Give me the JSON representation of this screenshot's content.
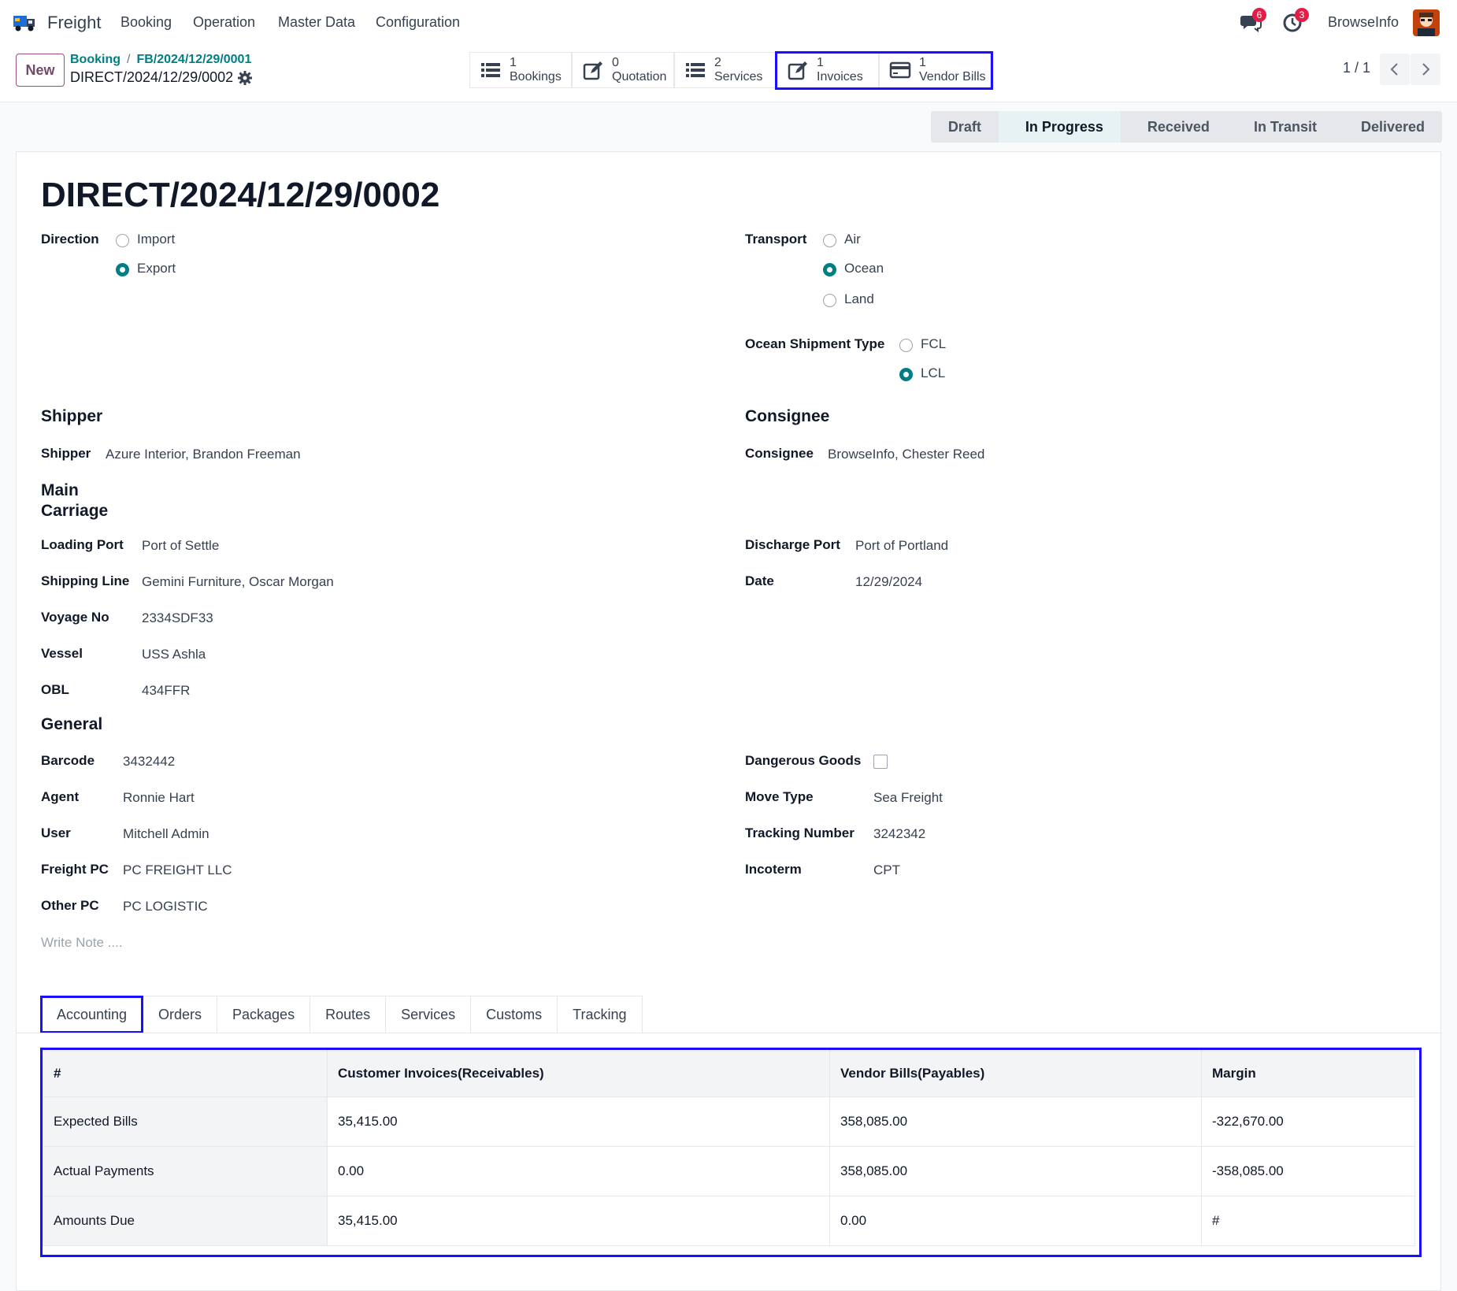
{
  "app": {
    "name": "Freight",
    "menu": [
      "Booking",
      "Operation",
      "Master Data",
      "Configuration"
    ],
    "messages_count": "6",
    "activities_count": "3",
    "user_name": "BrowseInfo"
  },
  "control": {
    "new_label": "New",
    "breadcrumb_parent": "Booking",
    "breadcrumb_separator": "/",
    "breadcrumb_current": "FB/2024/12/29/0001",
    "record_name": "DIRECT/2024/12/29/0002",
    "smart_buttons": [
      {
        "count": "1",
        "label": "Bookings",
        "icon": "list-icon"
      },
      {
        "count": "0",
        "label": "Quotation",
        "icon": "pencil-square-icon"
      },
      {
        "count": "2",
        "label": "Services",
        "icon": "list-icon"
      },
      {
        "count": "1",
        "label": "Invoices",
        "icon": "pencil-square-icon"
      },
      {
        "count": "1",
        "label": "Vendor Bills",
        "icon": "credit-card-icon"
      }
    ],
    "pager": "1 / 1"
  },
  "status": {
    "stages": [
      "Draft",
      "In Progress",
      "Received",
      "In Transit",
      "Delivered"
    ],
    "active": "In Progress"
  },
  "form": {
    "title": "DIRECT/2024/12/29/0002",
    "direction": {
      "label": "Direction",
      "options": [
        "Import",
        "Export"
      ],
      "selected": "Export"
    },
    "transport": {
      "label": "Transport",
      "options": [
        "Air",
        "Ocean",
        "Land"
      ],
      "selected": "Ocean"
    },
    "ocean_type": {
      "label": "Ocean Shipment Type",
      "options": [
        "FCL",
        "LCL"
      ],
      "selected": "LCL"
    },
    "shipper_section": "Shipper",
    "shipper": {
      "label": "Shipper",
      "value": "Azure Interior, Brandon Freeman"
    },
    "consignee_section": "Consignee",
    "consignee": {
      "label": "Consignee",
      "value": "BrowseInfo, Chester Reed"
    },
    "main_carriage_section": [
      "Main",
      "Carriage"
    ],
    "loading_port": {
      "label": "Loading Port",
      "value": "Port of Settle"
    },
    "shipping_line": {
      "label": "Shipping Line",
      "value": "Gemini Furniture, Oscar Morgan"
    },
    "voyage_no": {
      "label": "Voyage No",
      "value": "2334SDF33"
    },
    "vessel": {
      "label": "Vessel",
      "value": "USS Ashla"
    },
    "obl": {
      "label": "OBL",
      "value": "434FFR"
    },
    "discharge_port": {
      "label": "Discharge Port",
      "value": "Port of Portland"
    },
    "date": {
      "label": "Date",
      "value": "12/29/2024"
    },
    "general_section": "General",
    "barcode": {
      "label": "Barcode",
      "value": "3432442"
    },
    "agent": {
      "label": "Agent",
      "value": "Ronnie Hart"
    },
    "user": {
      "label": "User",
      "value": "Mitchell Admin"
    },
    "freight_pc": {
      "label": "Freight PC",
      "value": "PC FREIGHT LLC"
    },
    "other_pc": {
      "label": "Other PC",
      "value": "PC LOGISTIC"
    },
    "dangerous_goods": {
      "label": "Dangerous Goods",
      "checked": false
    },
    "move_type": {
      "label": "Move Type",
      "value": "Sea Freight"
    },
    "tracking_number": {
      "label": "Tracking Number",
      "value": "3242342"
    },
    "incoterm": {
      "label": "Incoterm",
      "value": "CPT"
    },
    "note_placeholder": "Write Note ...."
  },
  "tabs": [
    "Accounting",
    "Orders",
    "Packages",
    "Routes",
    "Services",
    "Customs",
    "Tracking"
  ],
  "accounting": {
    "headers": [
      "#",
      "Customer Invoices(Receivables)",
      "Vendor Bills(Payables)",
      "Margin"
    ],
    "rows": [
      [
        "Expected Bills",
        "35,415.00",
        "358,085.00",
        "-322,670.00"
      ],
      [
        "Actual Payments",
        "0.00",
        "358,085.00",
        "-358,085.00"
      ],
      [
        "Amounts Due",
        "35,415.00",
        "0.00",
        "#"
      ]
    ]
  },
  "colors": {
    "accent": "#017e84",
    "brand": "#714b67",
    "highlight": "#1a0fff",
    "badge": "#e11d48"
  }
}
